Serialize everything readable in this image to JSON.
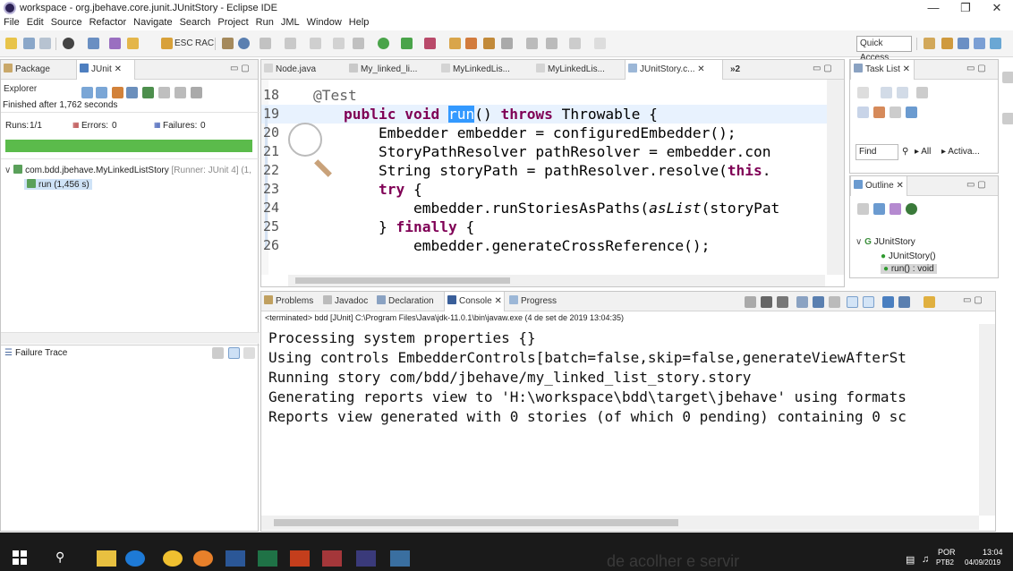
{
  "window": {
    "title": "workspace - org.jbehave.core.junit.JUnitStory - Eclipse IDE"
  },
  "menu": [
    "File",
    "Edit",
    "Source",
    "Refactor",
    "Navigate",
    "Search",
    "Project",
    "Run",
    "JML",
    "Window",
    "Help"
  ],
  "toolbar": {
    "esc": "ESC",
    "rac": "RAC",
    "quick_access": "Quick Access"
  },
  "left": {
    "tabs": [
      "Package Explorer",
      "JUnit"
    ],
    "finished": "Finished after 1,762 seconds",
    "runs_label": "Runs:",
    "runs_value": "1/1",
    "errors_label": "Errors:",
    "errors_value": "0",
    "failures_label": "Failures:",
    "failures_value": "0",
    "tree_root": "com.bdd.jbehave.MyLinkedListStory",
    "tree_root_runner": "[Runner: JUnit 4] (1,",
    "tree_child": "run (1,456 s)",
    "failure_trace": "Failure Trace"
  },
  "editor": {
    "tabs": [
      "Node.java",
      "My_linked_li...",
      "MyLinkedLis...",
      "MyLinkedLis...",
      "JUnitStory.c..."
    ],
    "overflow": "»2",
    "line_numbers": [
      "18",
      "19",
      "20",
      "21",
      "22",
      "23",
      "24",
      "25",
      "26"
    ],
    "lines": {
      "l18_ann": "@Test",
      "l19_kw1": "public void ",
      "l19_sel": "run",
      "l19_mid": "() ",
      "l19_kw2": "throws",
      "l19_end": " Throwable {",
      "l20": "    Embedder embedder = configuredEmbedder();",
      "l21": "    StoryPathResolver pathResolver = embedder.con",
      "l22_pre": "    String storyPath = pathResolver.resolve(",
      "l22_kw": "this",
      ".l22_end": ".",
      "l22_end": ".",
      "l23_kw": "    try",
      " l23_end": " {",
      "l23_end": " {",
      "l24_pre": "        embedder.runStoriesAsPaths(",
      "l24_it": "asList",
      "l24_end": "(storyPat",
      "l25_pre": "    } ",
      "l25_kw": "finally",
      "l25_end": " {",
      "l26": "        embedder.generateCrossReference();"
    }
  },
  "bottom": {
    "tabs": [
      "Problems",
      "Javadoc",
      "Declaration",
      "Console",
      "Progress"
    ],
    "terminated": "<terminated> bdd [JUnit] C:\\Program Files\\Java\\jdk-11.0.1\\bin\\javaw.exe (4 de set de 2019 13:04:35)",
    "console_lines": [
      "Processing system properties {}",
      "Using controls EmbedderControls[batch=false,skip=false,generateViewAfterSt",
      "Running story com/bdd/jbehave/my_linked_list_story.story",
      "Generating reports view to 'H:\\workspace\\bdd\\target\\jbehave' using formats",
      "Reports view generated with 0 stories (of which 0 pending) containing 0 sc"
    ]
  },
  "right": {
    "task_tab": "Task List",
    "find": "Find",
    "all": "All",
    "activate": "Activa...",
    "outline_tab": "Outline",
    "outline_root": "JUnitStory",
    "outline_ctor": "JUnitStory()",
    "outline_run": "run() : void"
  },
  "taskbar": {
    "lang": "POR",
    "lang2": "PTB2",
    "time": "13:04",
    "date": "04/09/2019",
    "bg_text": "de acolher e servir"
  },
  "colors": {
    "junit_bar": "#5bbb4b",
    "keyword": "#7f0055",
    "selection": "#3399ff",
    "taskbar": "#1a1a1a"
  }
}
